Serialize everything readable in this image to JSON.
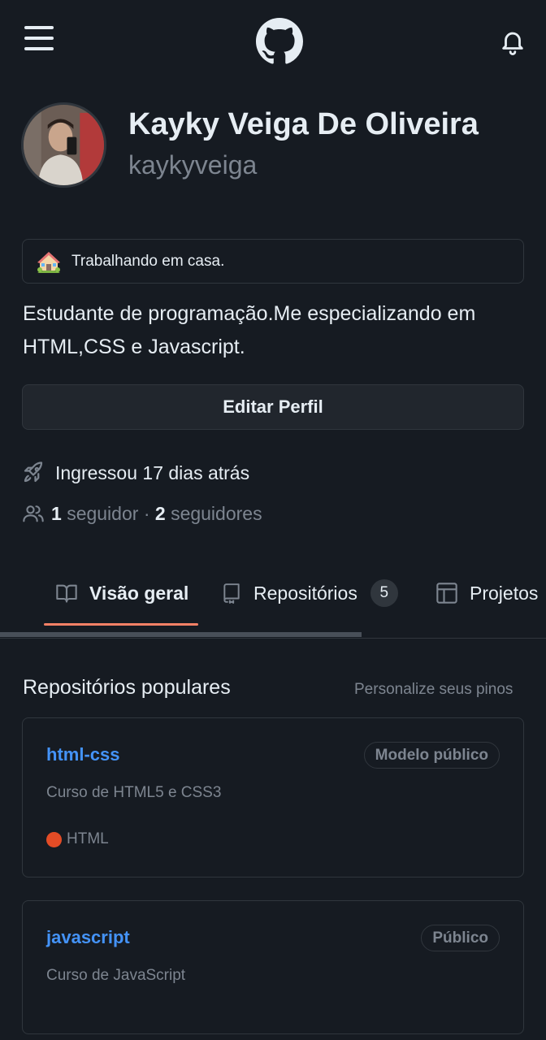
{
  "header": {
    "menu_icon": "hamburger-icon",
    "logo_icon": "github-logo-icon",
    "notifications_icon": "bell-icon"
  },
  "profile": {
    "full_name": "Kayky Veiga De Oliveira",
    "username": "kaykyveiga",
    "status": {
      "emoji": "house-with-garden-icon",
      "text": "Trabalhando em casa."
    },
    "bio": "Estudante de programação.Me especializando em HTML,CSS e Javascript.",
    "edit_button": "Editar Perfil",
    "joined": "Ingressou 17 dias atrás",
    "followers": {
      "followers_count": "1",
      "followers_label": "seguidor",
      "separator": "·",
      "following_count": "2",
      "following_label": "seguidores"
    }
  },
  "tabs": [
    {
      "label": "Visão geral",
      "icon": "book-icon",
      "selected": true
    },
    {
      "label": "Repositórios",
      "icon": "repo-icon",
      "count": "5"
    },
    {
      "label": "Projetos",
      "icon": "table-icon"
    }
  ],
  "popular": {
    "title": "Repositórios populares",
    "customize_link": "Personalize seus pinos",
    "repos": [
      {
        "name": "html-css",
        "badge": "Modelo público",
        "description": "Curso de HTML5 e CSS3",
        "language": "HTML",
        "language_color": "#e34c26"
      },
      {
        "name": "javascript",
        "badge": "Público",
        "description": "Curso de JavaScript"
      }
    ]
  },
  "colors": {
    "background": "#161b22",
    "link": "#4493f8",
    "tab_underline": "#f78166",
    "muted": "#7d8590"
  }
}
